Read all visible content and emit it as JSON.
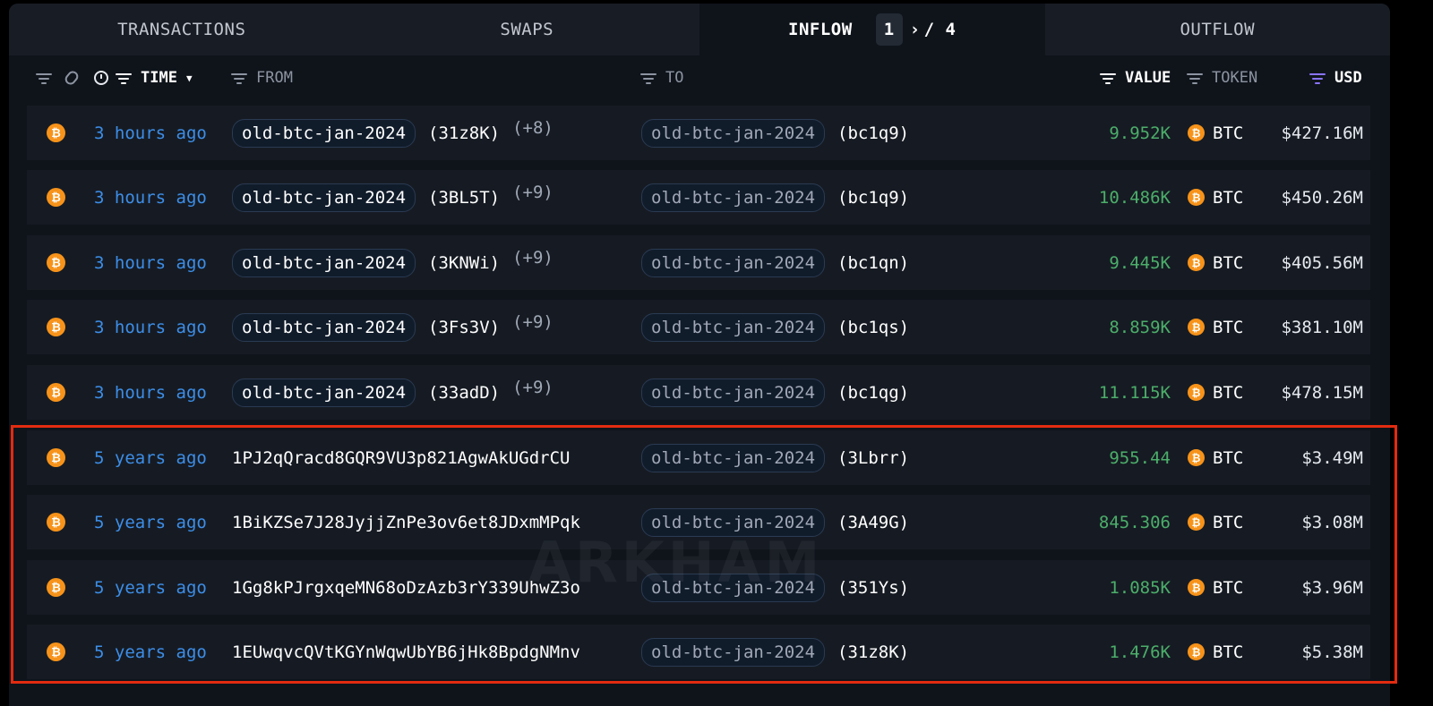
{
  "tabs": [
    {
      "label": "TRANSACTIONS",
      "active": false
    },
    {
      "label": "SWAPS",
      "active": false
    },
    {
      "label": "INFLOW",
      "active": true
    },
    {
      "label": "OUTFLOW",
      "active": false
    }
  ],
  "pager": {
    "current": "1",
    "separator": "/",
    "total": "4"
  },
  "columns": {
    "time": "TIME",
    "from": "FROM",
    "to": "TO",
    "value": "VALUE",
    "token": "TOKEN",
    "usd": "USD"
  },
  "icons": {
    "token_icon": "bitcoin-icon"
  },
  "colors": {
    "time": "#3d8ee8",
    "value": "#4cae6a",
    "highlight": "#e22b10",
    "btc": "#f7931a"
  },
  "rows": [
    {
      "time": "3 hours ago",
      "from_entity": "old-btc-jan-2024",
      "from_addr": "(31z8K)",
      "from_more": "(+8)",
      "to_entity": "old-btc-jan-2024",
      "to_addr": "(bc1q9)",
      "value": "9.952K",
      "token": "BTC",
      "usd": "$427.16M"
    },
    {
      "time": "3 hours ago",
      "from_entity": "old-btc-jan-2024",
      "from_addr": "(3BL5T)",
      "from_more": "(+9)",
      "to_entity": "old-btc-jan-2024",
      "to_addr": "(bc1q9)",
      "value": "10.486K",
      "token": "BTC",
      "usd": "$450.26M"
    },
    {
      "time": "3 hours ago",
      "from_entity": "old-btc-jan-2024",
      "from_addr": "(3KNWi)",
      "from_more": "(+9)",
      "to_entity": "old-btc-jan-2024",
      "to_addr": "(bc1qn)",
      "value": "9.445K",
      "token": "BTC",
      "usd": "$405.56M"
    },
    {
      "time": "3 hours ago",
      "from_entity": "old-btc-jan-2024",
      "from_addr": "(3Fs3V)",
      "from_more": "(+9)",
      "to_entity": "old-btc-jan-2024",
      "to_addr": "(bc1qs)",
      "value": "8.859K",
      "token": "BTC",
      "usd": "$381.10M"
    },
    {
      "time": "3 hours ago",
      "from_entity": "old-btc-jan-2024",
      "from_addr": "(33adD)",
      "from_more": "(+9)",
      "to_entity": "old-btc-jan-2024",
      "to_addr": "(bc1qg)",
      "value": "11.115K",
      "token": "BTC",
      "usd": "$478.15M"
    },
    {
      "time": "5 years ago",
      "from_full": "1PJ2qQracd8GQR9VU3p821AgwAkUGdrCU",
      "to_entity": "old-btc-jan-2024",
      "to_addr": "(3Lbrr)",
      "value": "955.44",
      "token": "BTC",
      "usd": "$3.49M"
    },
    {
      "time": "5 years ago",
      "from_full": "1BiKZSe7J28JyjjZnPe3ov6et8JDxmMPqk",
      "to_entity": "old-btc-jan-2024",
      "to_addr": "(3A49G)",
      "value": "845.306",
      "token": "BTC",
      "usd": "$3.08M"
    },
    {
      "time": "5 years ago",
      "from_full": "1Gg8kPJrgxqeMN68oDzAzb3rY339UhwZ3o",
      "to_entity": "old-btc-jan-2024",
      "to_addr": "(351Ys)",
      "value": "1.085K",
      "token": "BTC",
      "usd": "$3.96M"
    },
    {
      "time": "5 years ago",
      "from_full": "1EUwqvcQVtKGYnWqwUbYB6jHk8BpdgNMnv",
      "to_entity": "old-btc-jan-2024",
      "to_addr": "(31z8K)",
      "value": "1.476K",
      "token": "BTC",
      "usd": "$5.38M"
    }
  ],
  "watermark": "ARKHAM"
}
